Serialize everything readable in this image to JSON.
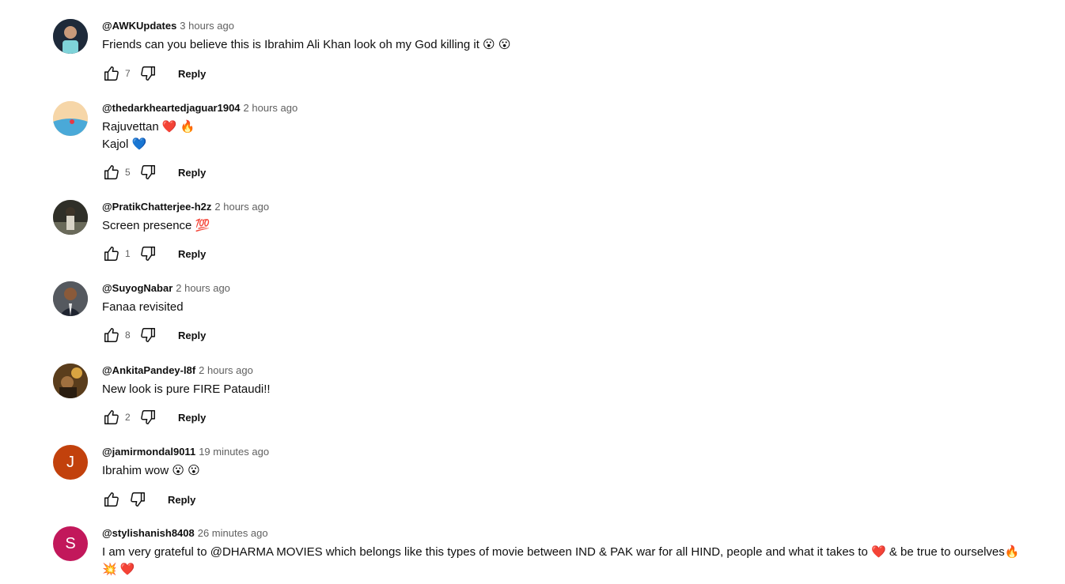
{
  "comments": [
    {
      "author": "@AWKUpdates",
      "time": "3 hours ago",
      "lines": [
        "Friends can you believe this is Ibrahim Ali Khan look oh my God killing it 😮 😮"
      ],
      "likes": "7",
      "reply_label": "Reply",
      "avatar_letter": "",
      "avatar_color": "#1e2a3a"
    },
    {
      "author": "@thedarkheartedjaguar1904",
      "time": "2 hours ago",
      "lines": [
        "Rajuvettan ❤️ 🔥",
        "Kajol 💙"
      ],
      "likes": "5",
      "reply_label": "Reply",
      "avatar_letter": "",
      "avatar_color": "#f3c99a"
    },
    {
      "author": "@PratikChatterjee-h2z",
      "time": "2 hours ago",
      "lines": [
        "Screen presence 💯"
      ],
      "likes": "1",
      "reply_label": "Reply",
      "avatar_letter": "",
      "avatar_color": "#3a3a2e"
    },
    {
      "author": "@SuyogNabar",
      "time": "2 hours ago",
      "lines": [
        "Fanaa revisited"
      ],
      "likes": "8",
      "reply_label": "Reply",
      "avatar_letter": "",
      "avatar_color": "#4a4e57"
    },
    {
      "author": "@AnkitaPandey-l8f",
      "time": "2 hours ago",
      "lines": [
        "New look is pure FIRE Pataudi!!"
      ],
      "likes": "2",
      "reply_label": "Reply",
      "avatar_letter": "",
      "avatar_color": "#6b4a22"
    },
    {
      "author": "@jamirmondal9011",
      "time": "19 minutes ago",
      "lines": [
        "Ibrahim wow 😮 😮"
      ],
      "likes": "",
      "reply_label": "Reply",
      "avatar_letter": "J",
      "avatar_color": "#c2410c"
    },
    {
      "author": "@stylishanish8408",
      "time": "26 minutes ago",
      "lines": [
        "I am very grateful to @DHARMA MOVIES which belongs like this types of movie between IND & PAK war for all HIND, people and what it takes to ❤️ & be true to ourselves🔥",
        "💥 ❤️"
      ],
      "likes": "",
      "reply_label": "Reply",
      "avatar_letter": "S",
      "avatar_color": "#c2185b"
    }
  ],
  "icons": {
    "like": "thumbs-up-icon",
    "dislike": "thumbs-down-icon"
  },
  "colors": {
    "text": "#0f0f0f",
    "secondary": "#606060"
  }
}
